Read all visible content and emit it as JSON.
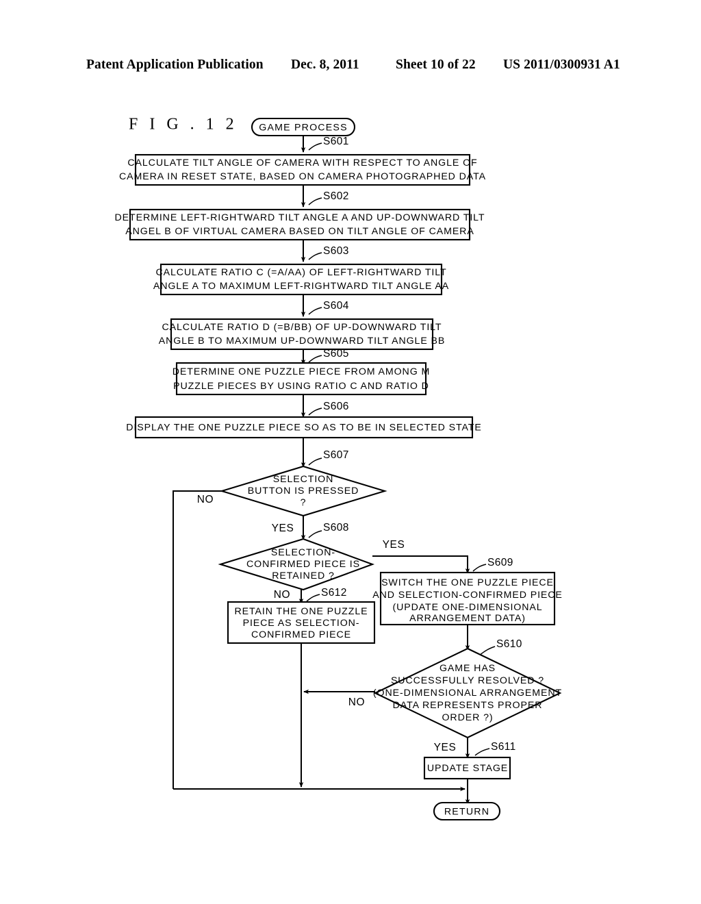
{
  "header": {
    "publication": "Patent Application Publication",
    "date": "Dec. 8, 2011",
    "sheet": "Sheet 10 of 22",
    "patent_number": "US 2011/0300931 A1"
  },
  "figure": {
    "title": "F I G .   1 2",
    "start_terminal": "GAME PROCESS",
    "end_terminal": "RETURN"
  },
  "steps": {
    "s601": {
      "label": "S601",
      "lines": [
        "CALCULATE TILT ANGLE OF CAMERA WITH RESPECT TO ANGLE OF",
        "CAMERA IN RESET STATE, BASED ON CAMERA PHOTOGRAPHED DATA"
      ]
    },
    "s602": {
      "label": "S602",
      "lines": [
        "DETERMINE LEFT-RIGHTWARD TILT ANGLE A AND UP-DOWNWARD TILT",
        "ANGEL B OF VIRTUAL CAMERA BASED ON TILT ANGLE OF CAMERA"
      ]
    },
    "s603": {
      "label": "S603",
      "lines": [
        "CALCULATE RATIO C (=A/AA) OF LEFT-RIGHTWARD TILT",
        "ANGLE A TO MAXIMUM LEFT-RIGHTWARD TILT ANGLE AA"
      ]
    },
    "s604": {
      "label": "S604",
      "lines": [
        "CALCULATE RATIO D (=B/BB) OF UP-DOWNWARD TILT",
        "ANGLE B TO MAXIMUM UP-DOWNWARD TILT ANGLE BB"
      ]
    },
    "s605": {
      "label": "S605",
      "lines": [
        "DETERMINE ONE PUZZLE PIECE FROM AMONG M",
        "PUZZLE PIECES BY USING RATIO C AND RATIO D"
      ]
    },
    "s606": {
      "label": "S606",
      "lines": [
        "DISPLAY THE ONE PUZZLE PIECE SO AS TO BE IN SELECTED STATE"
      ]
    },
    "s607": {
      "label": "S607",
      "lines": [
        "SELECTION",
        "BUTTON IS PRESSED",
        "?"
      ],
      "branch_no": "NO",
      "branch_yes": "YES"
    },
    "s608": {
      "label": "S608",
      "lines": [
        "SELECTION-",
        "CONFIRMED PIECE IS",
        "RETAINED ?"
      ],
      "branch_no": "NO",
      "branch_yes": "YES"
    },
    "s609": {
      "label": "S609",
      "lines": [
        "SWITCH THE ONE PUZZLE PIECE",
        "AND SELECTION-CONFIRMED PIECE",
        "(UPDATE ONE-DIMENSIONAL",
        "ARRANGEMENT DATA)"
      ]
    },
    "s610": {
      "label": "S610",
      "lines": [
        "GAME  HAS",
        "SUCCESSFULLY RESOLVED ?",
        "(ONE-DIMENSIONAL ARRANGEMENT",
        "DATA REPRESENTS PROPER",
        "ORDER ?)"
      ],
      "branch_no": "NO",
      "branch_yes": "YES"
    },
    "s611": {
      "label": "S611",
      "lines": [
        "UPDATE STAGE"
      ]
    },
    "s612": {
      "label": "S612",
      "lines": [
        "RETAIN THE ONE PUZZLE",
        "PIECE AS SELECTION-",
        "CONFIRMED PIECE"
      ]
    }
  }
}
